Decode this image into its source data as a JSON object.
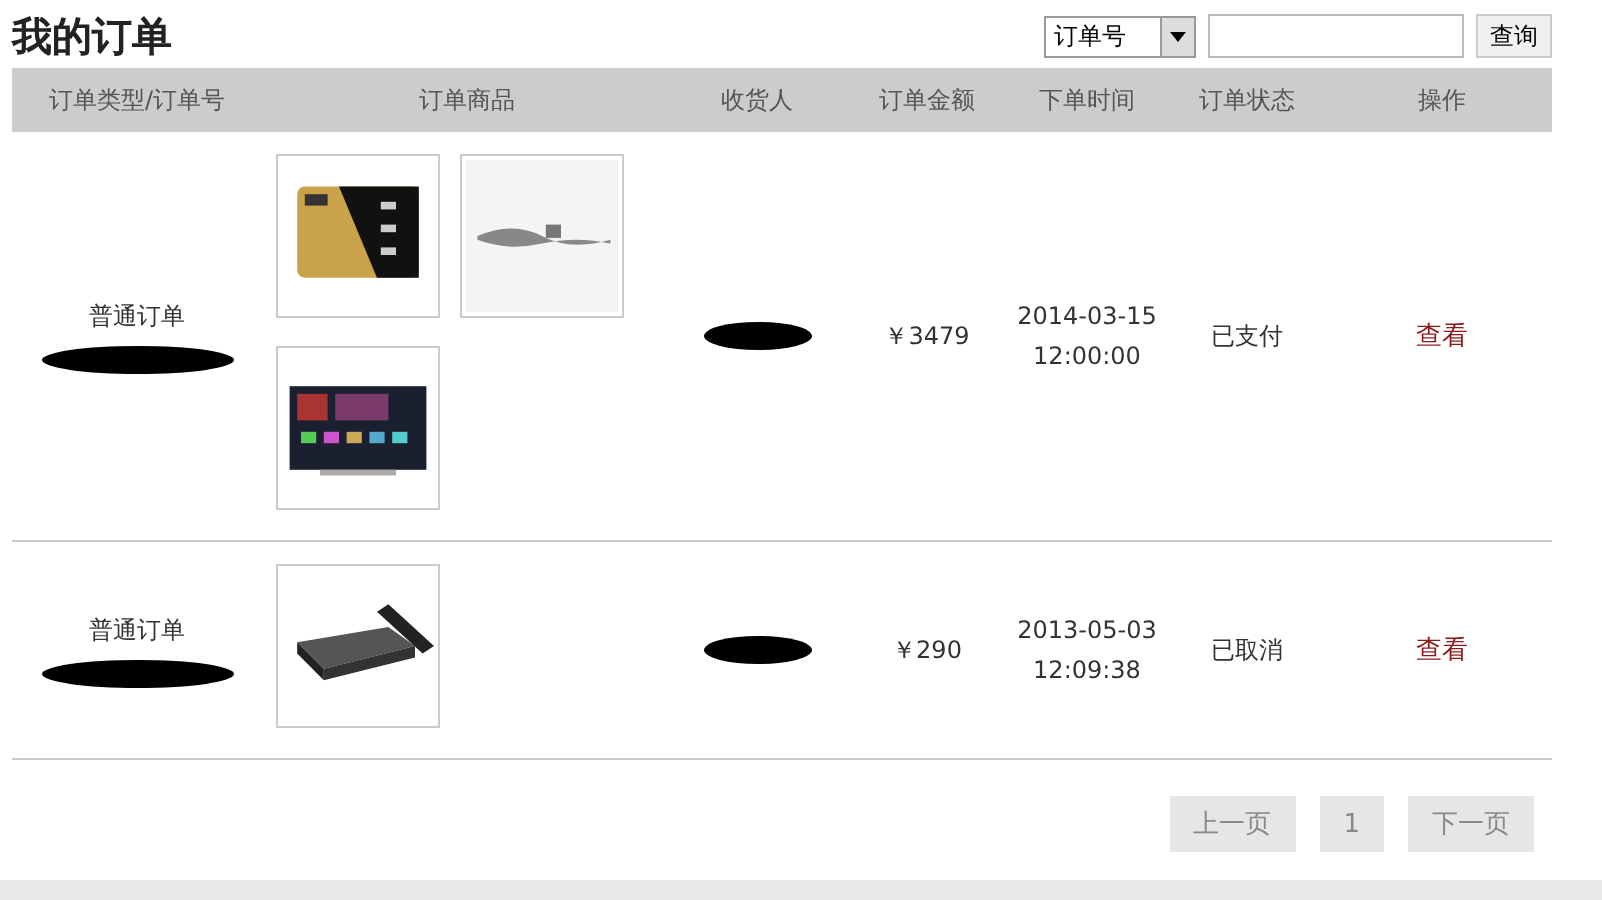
{
  "title": "我的订单",
  "search": {
    "field_option": "订单号",
    "button": "查询"
  },
  "table": {
    "columns": [
      "订单类型/订单号",
      "订单商品",
      "收货人",
      "订单金额",
      "下单时间",
      "订单状态",
      "操作"
    ],
    "rows": [
      {
        "type": "普通订单",
        "amount": "￥3479",
        "date": "2014-03-15",
        "time": "12:00:00",
        "status": "已支付",
        "action": "查看"
      },
      {
        "type": "普通订单",
        "amount": "￥290",
        "date": "2013-05-03",
        "time": "12:09:38",
        "status": "已取消",
        "action": "查看"
      }
    ]
  },
  "pagination": [
    {
      "label": "上一页",
      "disabled": true
    },
    {
      "label": "1",
      "disabled": true
    },
    {
      "label": "下一页",
      "disabled": true
    }
  ]
}
